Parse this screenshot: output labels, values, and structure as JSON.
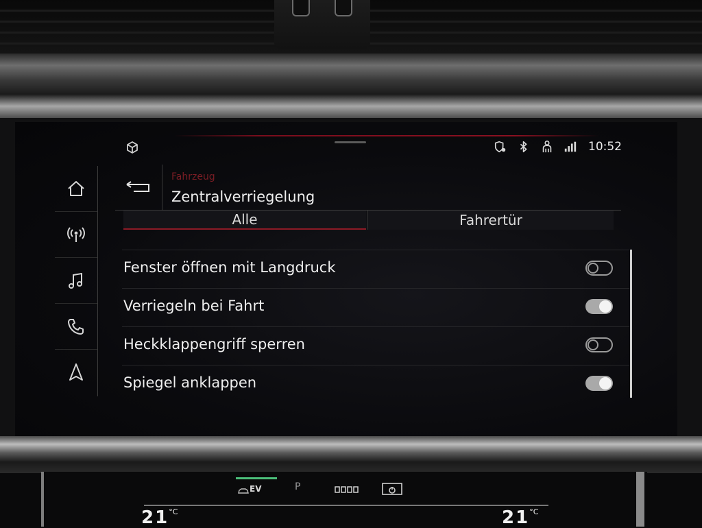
{
  "status": {
    "time": "10:52",
    "icons": [
      "cube-icon",
      "location-shield-icon",
      "bluetooth-icon",
      "person-seat-icon",
      "lte-signal-icon"
    ]
  },
  "nav": {
    "items": [
      {
        "name": "home",
        "icon": "home-icon"
      },
      {
        "name": "radio",
        "icon": "radio-antenna-icon"
      },
      {
        "name": "media",
        "icon": "music-note-icon"
      },
      {
        "name": "phone",
        "icon": "phone-icon"
      },
      {
        "name": "navigation",
        "icon": "navigation-arrow-icon"
      }
    ]
  },
  "header": {
    "breadcrumb": "Fahrzeug",
    "title": "Zentralverriegelung",
    "back_icon": "back-arrow-icon"
  },
  "tabs": [
    {
      "label": "Alle",
      "active": true
    },
    {
      "label": "Fahrertür",
      "active": false
    }
  ],
  "settings": [
    {
      "label": "Fenster öffnen mit Langdruck",
      "enabled": false
    },
    {
      "label": "Verriegeln bei Fahrt",
      "enabled": true
    },
    {
      "label": "Heckklappengriff sperren",
      "enabled": false
    },
    {
      "label": "Spiegel anklappen",
      "enabled": true
    }
  ],
  "climate": {
    "ev_label": "EV",
    "p_label": "P",
    "temp_left": "21",
    "temp_right": "21",
    "temp_unit": "°C"
  },
  "colors": {
    "accent_red": "#8d1b26",
    "toggle_on": "#a9a9a9",
    "ev_green": "#4cc07a"
  }
}
